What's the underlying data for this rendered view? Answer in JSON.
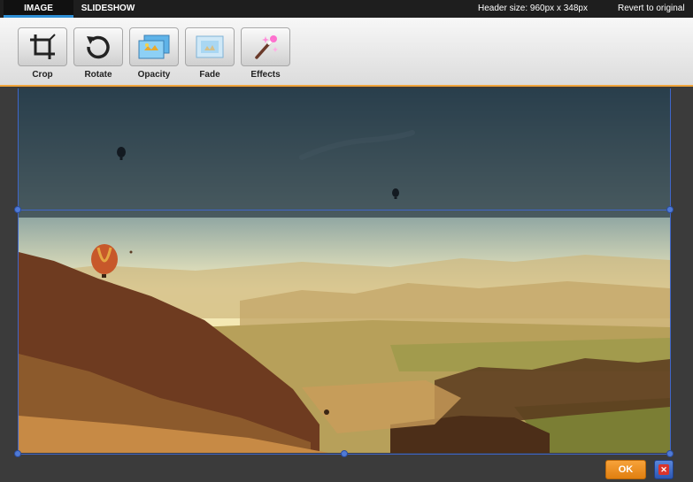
{
  "tabs": [
    {
      "label": "IMAGE"
    },
    {
      "label": "SLIDESHOW"
    }
  ],
  "header_size": "Header size: 960px x 348px",
  "revert_label": "Revert to original",
  "tools": [
    {
      "label": "Crop",
      "icon": "crop-icon"
    },
    {
      "label": "Rotate",
      "icon": "rotate-icon"
    },
    {
      "label": "Opacity",
      "icon": "opacity-icon"
    },
    {
      "label": "Fade",
      "icon": "fade-icon"
    },
    {
      "label": "Effects",
      "icon": "magic-wand-icon"
    }
  ],
  "ok_label": "OK",
  "close_icon": "close-icon",
  "colors": {
    "accent_tab": "#2e8fd6",
    "toolbar_border": "#f0a43a",
    "ok_button": "#e88a1a",
    "crop_frame": "#3f66c9"
  }
}
